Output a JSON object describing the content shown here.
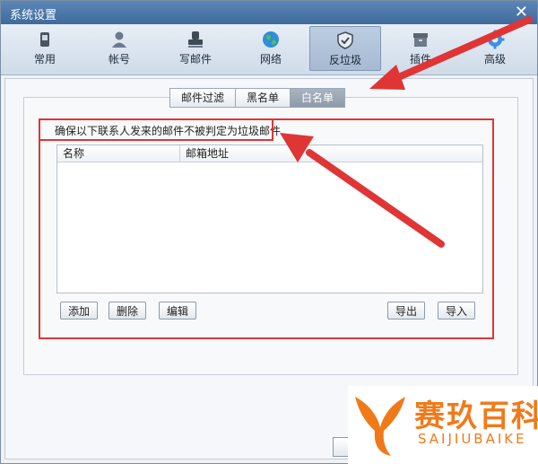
{
  "window": {
    "title": "系统设置",
    "close_glyph": "✕"
  },
  "toolbar": {
    "items": [
      {
        "label": "常用",
        "icon": "phone-icon"
      },
      {
        "label": "帐号",
        "icon": "user-icon"
      },
      {
        "label": "写邮件",
        "icon": "stamp-icon"
      },
      {
        "label": "网络",
        "icon": "globe-icon"
      },
      {
        "label": "反垃圾",
        "icon": "shield-icon",
        "active": true
      },
      {
        "label": "插件",
        "icon": "box-icon"
      },
      {
        "label": "高级",
        "icon": "gear-icon"
      }
    ]
  },
  "subtabs": [
    {
      "label": "邮件过滤"
    },
    {
      "label": "黑名单"
    },
    {
      "label": "白名单",
      "selected": true
    }
  ],
  "whitelist": {
    "description": "确保以下联系人发来的邮件不被判定为垃圾邮件",
    "columns": [
      "名称",
      "邮箱地址"
    ],
    "rows": []
  },
  "buttons": {
    "add": "添加",
    "delete": "删除",
    "edit": "编辑",
    "export": "导出",
    "import": "导入"
  },
  "watermark": {
    "brand_cn": "赛玖百科",
    "brand_en": "SAIJIUBAIKE"
  },
  "colors": {
    "annotation_red": "#e03535",
    "active_tab": "#a6bad2",
    "watermark_orange": "#f07a1a"
  }
}
